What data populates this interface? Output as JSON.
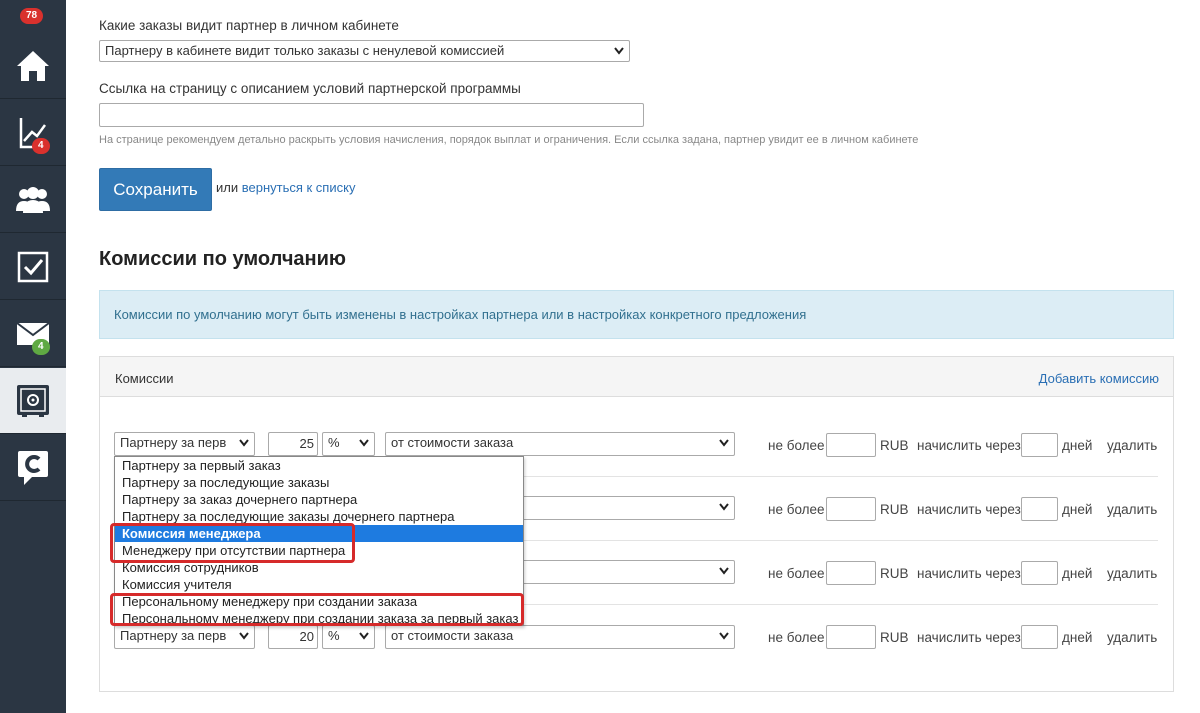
{
  "sidebar": {
    "top_badge": "78",
    "items": [
      {
        "name": "home",
        "badge": ""
      },
      {
        "name": "stats",
        "badge": "4"
      },
      {
        "name": "users",
        "badge": ""
      },
      {
        "name": "tasks",
        "badge": ""
      },
      {
        "name": "mail",
        "badge": "4"
      },
      {
        "name": "safe",
        "badge": ""
      },
      {
        "name": "brand",
        "badge": ""
      }
    ]
  },
  "form": {
    "orders_label": "Какие заказы видит партнер в личном кабинете",
    "orders_select": "Партнеру в кабинете видит только заказы с ненулевой комиссией",
    "link_label": "Ссылка на страницу с описанием условий партнерской программы",
    "link_value": "",
    "link_hint": "На странице рекомендуем детально раскрыть условия начисления, порядок выплат и ограничения. Если ссылка задана, партнер увидит ее в личном кабинете",
    "save_label": "Сохранить",
    "or_text": "или",
    "back_link": "вернуться к списку"
  },
  "commissions": {
    "heading": "Комиссии по умолчанию",
    "info": "Комиссии по умолчанию могут быть изменены в настройках партнера или в настройках конкретного предложения",
    "panel_title": "Комиссии",
    "add_link": "Добавить комиссию",
    "labels": {
      "not_more": "не более",
      "currency": "RUB",
      "charge_after": "начислить через",
      "days": "дней",
      "delete": "удалить"
    },
    "rows": [
      {
        "type": "Партнеру за перв",
        "value": "25",
        "unit": "%",
        "base": "от стоимости заказа"
      },
      {
        "type": "",
        "value": "",
        "unit": "",
        "base": ""
      },
      {
        "type": "",
        "value": "",
        "unit": "",
        "base": ""
      },
      {
        "type": "Партнеру за перв",
        "value": "20",
        "unit": "%",
        "base": "от стоимости заказа"
      }
    ]
  },
  "dropdown": {
    "options": [
      "Партнеру за первый заказ",
      "Партнеру за последующие заказы",
      "Партнеру за заказ дочернего партнера",
      "Партнеру за последующие заказы дочернего партнера",
      "Комиссия менеджера",
      "Менеджеру при отсутствии партнера",
      "Комиссия сотрудников",
      "Комиссия учителя",
      "Персональному менеджеру при создании заказа",
      "Персональному менеджеру при создании заказа за первый заказ"
    ],
    "selected_index": 4,
    "highlight_color": "#d62a2a",
    "selected_color": "#1e7be0"
  }
}
